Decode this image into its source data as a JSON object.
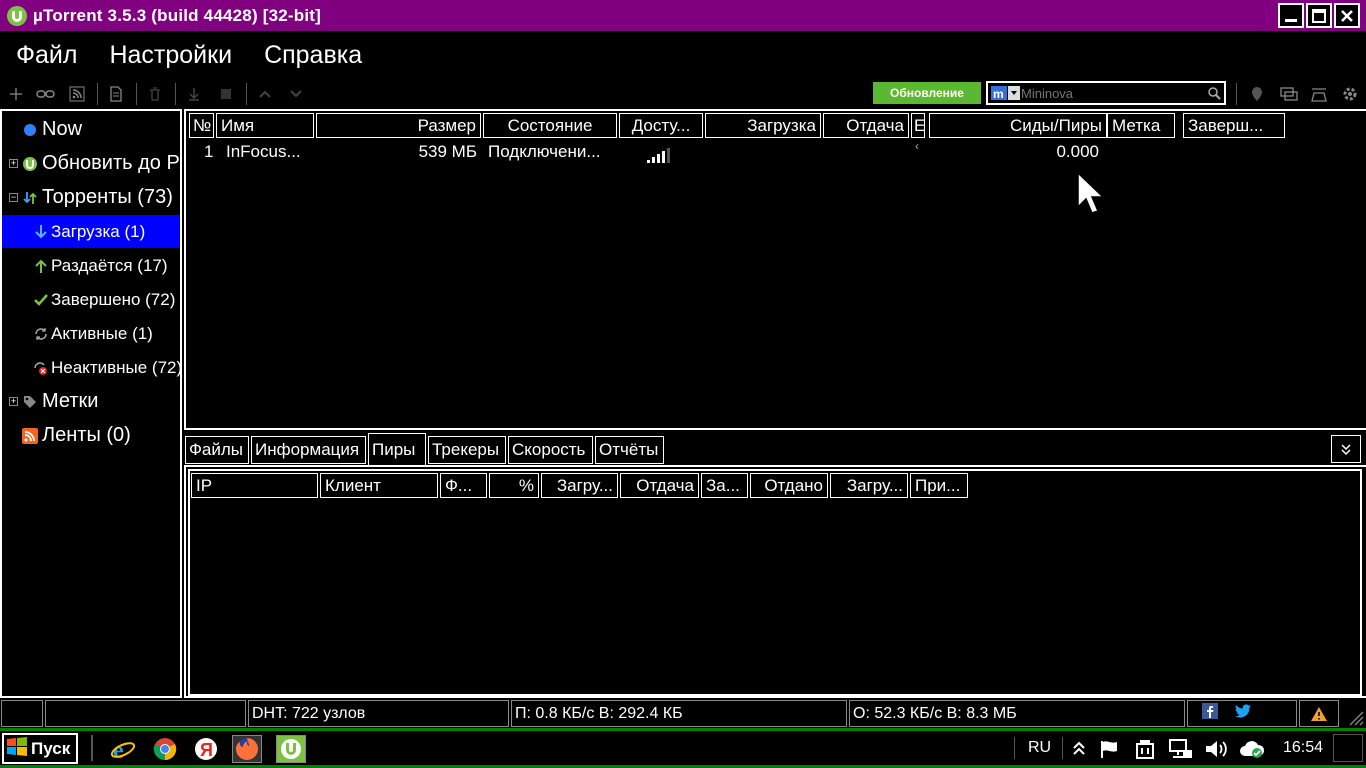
{
  "window": {
    "title": "µTorrent 3.5.3  (build 44428) [32-bit]"
  },
  "menu": {
    "file": "Файл",
    "settings": "Настройки",
    "help": "Справка"
  },
  "toolbar": {
    "update_label": "Обновление",
    "search_placeholder": "Mininova"
  },
  "sidebar": {
    "now": "Now",
    "update": "Обновить до Pro",
    "torrents": "Торренты (73)",
    "downloading": "Загрузка (1)",
    "seeding": "Раздаётся (17)",
    "completed": "Завершено (72)",
    "active": "Активные (1)",
    "inactive": "Неактивные (72)",
    "labels": "Метки",
    "feeds": "Ленты (0)"
  },
  "torrent_table": {
    "columns": {
      "num": "№",
      "name": "Имя",
      "size": "Размер",
      "status": "Состояние",
      "availability": "Досту...",
      "download": "Загрузка",
      "upload": "Отдача",
      "eta": "E",
      "seeds_peers": "Сиды/Пиры",
      "label": "Метка",
      "completed": "Заверш..."
    },
    "rows": [
      {
        "num": "1",
        "name": "InFocus...",
        "size": "539 МБ",
        "status": "Подключени...",
        "eta": "‹",
        "seeds_peers": "0.000",
        "signal_level": 0.8
      }
    ]
  },
  "tabs": {
    "files": "Файлы",
    "info": "Информация",
    "peers": "Пиры",
    "trackers": "Трекеры",
    "speed": "Скорость",
    "logs": "Отчёты"
  },
  "peers_table": {
    "columns": {
      "ip": "IP",
      "client": "Клиент",
      "flags": "Ф...",
      "percent": "%",
      "download": "Загру...",
      "upload": "Отдача",
      "requests": "За...",
      "uploaded": "Отдано",
      "downloaded": "Загру...",
      "reason": "При..."
    }
  },
  "statusbar": {
    "dht": "DHT: 722 узлов",
    "download": "П: 0.8 КБ/с В: 292.4 КБ",
    "upload": "О: 52.3 КБ/с В: 8.3 МБ"
  },
  "taskbar": {
    "start": "Пуск",
    "lang": "RU",
    "clock": "16:54"
  },
  "colors": {
    "titlebar": "#800080",
    "selected": "#0000ff",
    "update_btn": "#5cb830",
    "taskbar_border": "#008000"
  }
}
